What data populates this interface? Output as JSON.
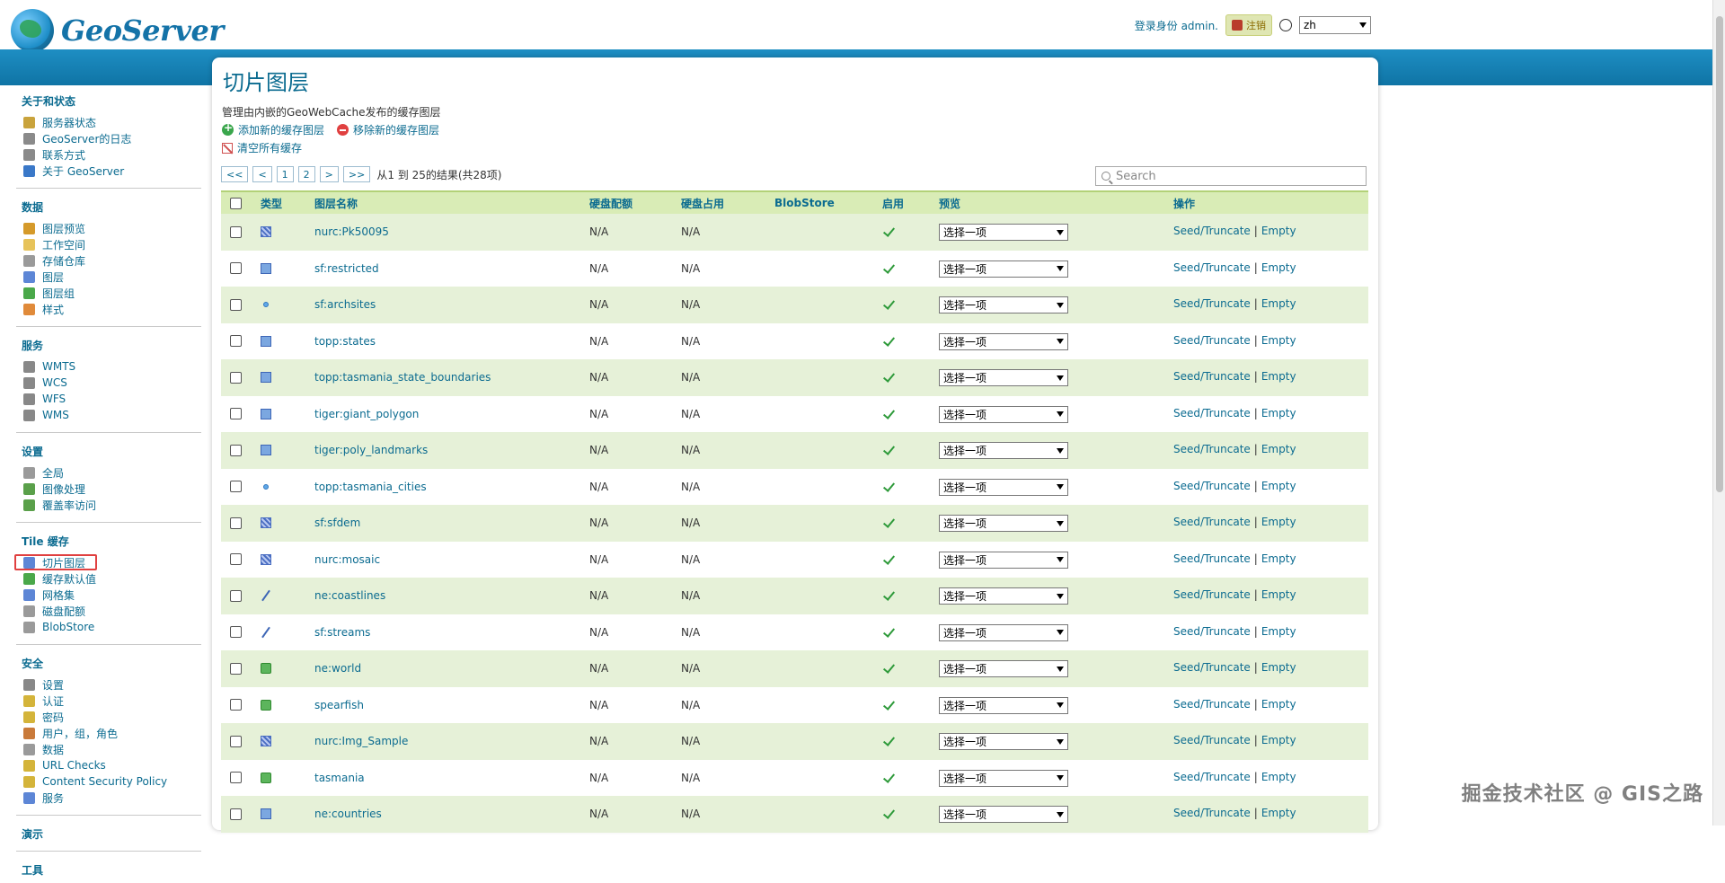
{
  "header": {
    "brand": "GeoServer",
    "login_text": "登录身份 admin.",
    "logout_label": "注销",
    "lang_value": "zh"
  },
  "sidebar": {
    "sections": [
      {
        "title": "关于和状态",
        "items": [
          {
            "label": "服务器状态",
            "icon": "server-status-icon",
            "color": "#c9a33c"
          },
          {
            "label": "GeoServer的日志",
            "icon": "log-icon",
            "color": "#8a8a8a"
          },
          {
            "label": "联系方式",
            "icon": "contact-icon",
            "color": "#8a8a8a"
          },
          {
            "label": "关于 GeoServer",
            "icon": "about-icon",
            "color": "#3a78c8"
          }
        ]
      },
      {
        "title": "数据",
        "items": [
          {
            "label": "图层预览",
            "icon": "layer-preview-icon",
            "color": "#d59a2a"
          },
          {
            "label": "工作空间",
            "icon": "workspace-icon",
            "color": "#e7c35a"
          },
          {
            "label": "存储仓库",
            "icon": "store-icon",
            "color": "#9a9a9a"
          },
          {
            "label": "图层",
            "icon": "layers-icon",
            "color": "#5d86d6"
          },
          {
            "label": "图层组",
            "icon": "layer-group-icon",
            "color": "#4aa84a"
          },
          {
            "label": "样式",
            "icon": "style-icon",
            "color": "#e08a3a"
          }
        ]
      },
      {
        "title": "服务",
        "items": [
          {
            "label": "WMTS",
            "icon": "wmts-icon",
            "color": "#888888"
          },
          {
            "label": "WCS",
            "icon": "wcs-icon",
            "color": "#888888"
          },
          {
            "label": "WFS",
            "icon": "wfs-icon",
            "color": "#888888"
          },
          {
            "label": "WMS",
            "icon": "wms-icon",
            "color": "#888888"
          }
        ]
      },
      {
        "title": "设置",
        "items": [
          {
            "label": "全局",
            "icon": "global-icon",
            "color": "#9a9a9a"
          },
          {
            "label": "图像处理",
            "icon": "image-processing-icon",
            "color": "#5aa04a"
          },
          {
            "label": "覆盖率访问",
            "icon": "coverage-access-icon",
            "color": "#5aa04a"
          }
        ]
      },
      {
        "title": "Tile 缓存",
        "items": [
          {
            "label": "切片图层",
            "icon": "tile-layers-icon",
            "color": "#5d86d6",
            "active": true
          },
          {
            "label": "缓存默认值",
            "icon": "cache-defaults-icon",
            "color": "#4aa84a"
          },
          {
            "label": "网格集",
            "icon": "gridsets-icon",
            "color": "#5d86d6"
          },
          {
            "label": "磁盘配额",
            "icon": "disk-quota-icon",
            "color": "#9a9a9a"
          },
          {
            "label": "BlobStore",
            "icon": "blobstore-icon",
            "color": "#9a9a9a"
          }
        ]
      },
      {
        "title": "安全",
        "items": [
          {
            "label": "设置",
            "icon": "security-settings-icon",
            "color": "#888888"
          },
          {
            "label": "认证",
            "icon": "auth-icon",
            "color": "#d4b43a"
          },
          {
            "label": "密码",
            "icon": "password-icon",
            "color": "#d4b43a"
          },
          {
            "label": "用户，组，角色",
            "icon": "users-icon",
            "color": "#c97a3a"
          },
          {
            "label": "数据",
            "icon": "data-security-icon",
            "color": "#9a9a9a"
          },
          {
            "label": "URL Checks",
            "icon": "url-checks-icon",
            "color": "#d4b43a"
          },
          {
            "label": "Content Security Policy",
            "icon": "csp-icon",
            "color": "#d4b43a"
          },
          {
            "label": "服务",
            "icon": "service-security-icon",
            "color": "#5d86d6"
          }
        ]
      },
      {
        "title": "演示",
        "items": []
      },
      {
        "title": "工具",
        "items": []
      }
    ]
  },
  "main": {
    "title": "切片图层",
    "description": "管理由内嵌的GeoWebCache发布的缓存图层",
    "add_label": "添加新的缓存图层",
    "remove_label": "移除新的缓存图层",
    "clear_label": "清空所有缓存",
    "pager": {
      "first": "<<",
      "prev": "<",
      "page1": "1",
      "page2": "2",
      "next": ">",
      "last": ">>",
      "info": "从1 到 25的结果(共28项)"
    },
    "search_placeholder": "Search",
    "columns": {
      "type": "类型",
      "name": "图层名称",
      "quota": "硬盘配额",
      "usage": "硬盘占用",
      "blobstore": "BlobStore",
      "enabled": "启用",
      "preview": "预览",
      "ops": "操作"
    },
    "preview_select": "选择一项",
    "op_seed": "Seed/Truncate",
    "op_sep": "|",
    "op_empty": "Empty",
    "rows": [
      {
        "type": "raster",
        "name": "nurc:Pk50095",
        "quota": "N/A",
        "usage": "N/A",
        "enabled": true
      },
      {
        "type": "polygon",
        "name": "sf:restricted",
        "quota": "N/A",
        "usage": "N/A",
        "enabled": true
      },
      {
        "type": "point",
        "name": "sf:archsites",
        "quota": "N/A",
        "usage": "N/A",
        "enabled": true
      },
      {
        "type": "polygon",
        "name": "topp:states",
        "quota": "N/A",
        "usage": "N/A",
        "enabled": true
      },
      {
        "type": "polygon",
        "name": "topp:tasmania_state_boundaries",
        "quota": "N/A",
        "usage": "N/A",
        "enabled": true
      },
      {
        "type": "polygon",
        "name": "tiger:giant_polygon",
        "quota": "N/A",
        "usage": "N/A",
        "enabled": true
      },
      {
        "type": "polygon",
        "name": "tiger:poly_landmarks",
        "quota": "N/A",
        "usage": "N/A",
        "enabled": true
      },
      {
        "type": "point",
        "name": "topp:tasmania_cities",
        "quota": "N/A",
        "usage": "N/A",
        "enabled": true
      },
      {
        "type": "raster",
        "name": "sf:sfdem",
        "quota": "N/A",
        "usage": "N/A",
        "enabled": true
      },
      {
        "type": "raster",
        "name": "nurc:mosaic",
        "quota": "N/A",
        "usage": "N/A",
        "enabled": true
      },
      {
        "type": "line",
        "name": "ne:coastlines",
        "quota": "N/A",
        "usage": "N/A",
        "enabled": true
      },
      {
        "type": "line",
        "name": "sf:streams",
        "quota": "N/A",
        "usage": "N/A",
        "enabled": true
      },
      {
        "type": "group",
        "name": "ne:world",
        "quota": "N/A",
        "usage": "N/A",
        "enabled": true
      },
      {
        "type": "group",
        "name": "spearfish",
        "quota": "N/A",
        "usage": "N/A",
        "enabled": true
      },
      {
        "type": "raster",
        "name": "nurc:Img_Sample",
        "quota": "N/A",
        "usage": "N/A",
        "enabled": true
      },
      {
        "type": "group",
        "name": "tasmania",
        "quota": "N/A",
        "usage": "N/A",
        "enabled": true
      },
      {
        "type": "polygon",
        "name": "ne:countries",
        "quota": "N/A",
        "usage": "N/A",
        "enabled": true
      }
    ]
  },
  "watermark": "掘金技术社区 @ GIS之路"
}
